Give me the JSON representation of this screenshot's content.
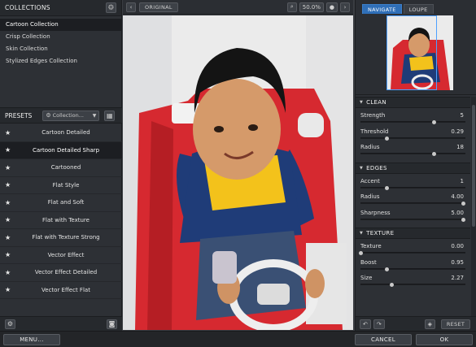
{
  "collections": {
    "title": "COLLECTIONS",
    "items": [
      {
        "label": "Cartoon Collection",
        "selected": true
      },
      {
        "label": "Crisp Collection",
        "selected": false
      },
      {
        "label": "Skin Collection",
        "selected": false
      },
      {
        "label": "Stylized Edges Collection",
        "selected": false
      }
    ]
  },
  "presets": {
    "title": "PRESETS",
    "collection_dropdown": "Collection...",
    "items": [
      {
        "label": "Cartoon Detailed",
        "selected": false
      },
      {
        "label": "Cartoon Detailed Sharp",
        "selected": true
      },
      {
        "label": "Cartooned",
        "selected": false
      },
      {
        "label": "Flat Style",
        "selected": false
      },
      {
        "label": "Flat and Soft",
        "selected": false
      },
      {
        "label": "Flat with Texture",
        "selected": false
      },
      {
        "label": "Flat with Texture Strong",
        "selected": false
      },
      {
        "label": "Vector Effect",
        "selected": false
      },
      {
        "label": "Vector Effect Detailed",
        "selected": false
      },
      {
        "label": "Vector Effect Flat",
        "selected": false
      }
    ]
  },
  "toolbar": {
    "prev": "‹",
    "original_label": "ORIGINAL",
    "zoom": "50.0%",
    "next": "›"
  },
  "preview_tabs": {
    "navigate": "NAVIGATE",
    "loupe": "LOUPE"
  },
  "sections": [
    {
      "title": "CLEAN",
      "sliders": [
        {
          "name": "Strength",
          "value": "5",
          "level": 0.7
        },
        {
          "name": "Threshold",
          "value": "0.29",
          "level": 0.25
        },
        {
          "name": "Radius",
          "value": "18",
          "level": 0.7
        }
      ]
    },
    {
      "title": "EDGES",
      "sliders": [
        {
          "name": "Accent",
          "value": "1",
          "level": 0.25
        },
        {
          "name": "Radius",
          "value": "4.00",
          "level": 0.98
        },
        {
          "name": "Sharpness",
          "value": "5.00",
          "level": 0.98
        }
      ]
    },
    {
      "title": "TEXTURE",
      "sliders": [
        {
          "name": "Texture",
          "value": "0.00",
          "level": 0.0
        },
        {
          "name": "Boost",
          "value": "0.95",
          "level": 0.25
        },
        {
          "name": "Size",
          "value": "2.27",
          "level": 0.3
        }
      ]
    }
  ],
  "footer": {
    "menu": "MENU...",
    "cancel": "CANCEL",
    "ok": "OK",
    "reset": "RESET"
  },
  "colors": {
    "accent": "#2f6fb8",
    "panel": "#2d3035"
  }
}
